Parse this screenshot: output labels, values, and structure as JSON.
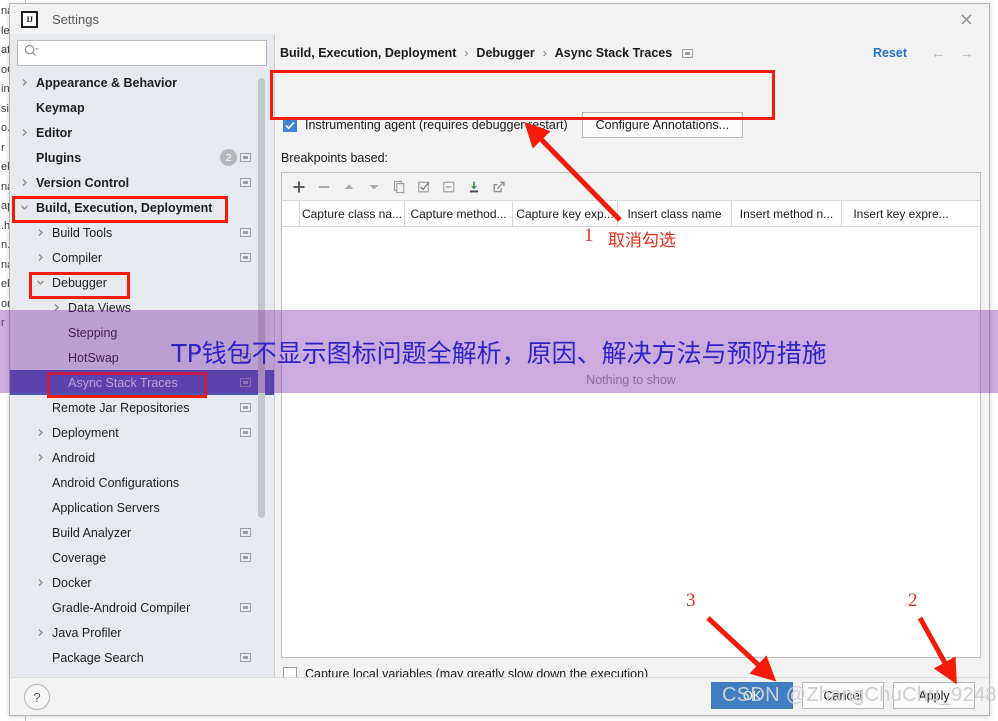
{
  "window": {
    "title": "Settings",
    "logo_text": "IJ",
    "close_icon": "close-icon"
  },
  "sidebar": {
    "search": {
      "value": "",
      "placeholder": "",
      "icon": "search-icon"
    },
    "items": [
      {
        "label": "Appearance & Behavior",
        "arrow": "right",
        "bold": true,
        "indent": 8,
        "badge": "",
        "mark": false,
        "selected": false
      },
      {
        "label": "Keymap",
        "arrow": "none",
        "bold": true,
        "indent": 8,
        "badge": "",
        "mark": false,
        "selected": false
      },
      {
        "label": "Editor",
        "arrow": "right",
        "bold": true,
        "indent": 8,
        "badge": "",
        "mark": false,
        "selected": false
      },
      {
        "label": "Plugins",
        "arrow": "none",
        "bold": true,
        "indent": 8,
        "badge": "2",
        "mark": true,
        "selected": false
      },
      {
        "label": "Version Control",
        "arrow": "right",
        "bold": true,
        "indent": 8,
        "badge": "",
        "mark": true,
        "selected": false
      },
      {
        "label": "Build, Execution, Deployment",
        "arrow": "down",
        "bold": true,
        "indent": 8,
        "badge": "",
        "mark": false,
        "selected": false
      },
      {
        "label": "Build Tools",
        "arrow": "right",
        "bold": false,
        "indent": 24,
        "badge": "",
        "mark": true,
        "selected": false
      },
      {
        "label": "Compiler",
        "arrow": "right",
        "bold": false,
        "indent": 24,
        "badge": "",
        "mark": true,
        "selected": false
      },
      {
        "label": "Debugger",
        "arrow": "down",
        "bold": false,
        "indent": 24,
        "badge": "",
        "mark": false,
        "selected": false
      },
      {
        "label": "Data Views",
        "arrow": "right",
        "bold": false,
        "indent": 40,
        "badge": "",
        "mark": false,
        "selected": false
      },
      {
        "label": "Stepping",
        "arrow": "none",
        "bold": false,
        "indent": 40,
        "badge": "",
        "mark": false,
        "selected": false
      },
      {
        "label": "HotSwap",
        "arrow": "none",
        "bold": false,
        "indent": 40,
        "badge": "",
        "mark": true,
        "selected": false
      },
      {
        "label": "Async Stack Traces",
        "arrow": "none",
        "bold": false,
        "indent": 40,
        "badge": "",
        "mark": true,
        "selected": true
      },
      {
        "label": "Remote Jar Repositories",
        "arrow": "none",
        "bold": false,
        "indent": 24,
        "badge": "",
        "mark": true,
        "selected": false
      },
      {
        "label": "Deployment",
        "arrow": "right",
        "bold": false,
        "indent": 24,
        "badge": "",
        "mark": true,
        "selected": false
      },
      {
        "label": "Android",
        "arrow": "right",
        "bold": false,
        "indent": 24,
        "badge": "",
        "mark": false,
        "selected": false
      },
      {
        "label": "Android Configurations",
        "arrow": "none",
        "bold": false,
        "indent": 24,
        "badge": "",
        "mark": false,
        "selected": false
      },
      {
        "label": "Application Servers",
        "arrow": "none",
        "bold": false,
        "indent": 24,
        "badge": "",
        "mark": false,
        "selected": false
      },
      {
        "label": "Build Analyzer",
        "arrow": "none",
        "bold": false,
        "indent": 24,
        "badge": "",
        "mark": true,
        "selected": false
      },
      {
        "label": "Coverage",
        "arrow": "none",
        "bold": false,
        "indent": 24,
        "badge": "",
        "mark": true,
        "selected": false
      },
      {
        "label": "Docker",
        "arrow": "right",
        "bold": false,
        "indent": 24,
        "badge": "",
        "mark": false,
        "selected": false
      },
      {
        "label": "Gradle-Android Compiler",
        "arrow": "none",
        "bold": false,
        "indent": 24,
        "badge": "",
        "mark": true,
        "selected": false
      },
      {
        "label": "Java Profiler",
        "arrow": "right",
        "bold": false,
        "indent": 24,
        "badge": "",
        "mark": false,
        "selected": false
      },
      {
        "label": "Package Search",
        "arrow": "none",
        "bold": false,
        "indent": 24,
        "badge": "",
        "mark": true,
        "selected": false
      }
    ]
  },
  "main": {
    "breadcrumb": [
      "Build, Execution, Deployment",
      "Debugger",
      "Async Stack Traces"
    ],
    "breadcrumb_separator": "›",
    "reset_label": "Reset",
    "nav_back_icon": "arrow-left-icon",
    "nav_forward_icon": "arrow-right-icon",
    "instrumenting_agent": {
      "label": "Instrumenting agent (requires debugger restart)",
      "checked": true
    },
    "configure_annotations_label": "Configure Annotations...",
    "breakpoints_label": "Breakpoints based:",
    "toolbar_icons": [
      "add-icon",
      "remove-icon",
      "move-up-icon",
      "move-down-icon",
      "copy-icon",
      "check-all-icon",
      "uncheck-all-icon",
      "import-icon",
      "export-icon"
    ],
    "table_columns": [
      "Capture class na...",
      "Capture method...",
      "Capture key exp...",
      "Insert class name",
      "Insert method n...",
      "Insert key expre..."
    ],
    "empty_text": "Nothing to show",
    "capture_local_variables": {
      "label": "Capture local variables (may greatly slow down the execution)",
      "checked": false
    }
  },
  "footer": {
    "help_label": "?",
    "buttons": [
      {
        "label": "OK",
        "primary": true
      },
      {
        "label": "Cancel",
        "primary": false
      },
      {
        "label": "Apply",
        "primary": false
      }
    ]
  },
  "annotations": {
    "step1_number": "1",
    "step1_text": "取消勾选",
    "step2_number": "2",
    "step3_number": "3",
    "red": "#f51b0a"
  },
  "overlay": {
    "banner_text": "TP钱包不显示图标问题全解析，原因、解决方法与预防措施",
    "banner_color": "#2f23c8",
    "watermark": "CSDN @ZhangChuChu_9248"
  },
  "background_strip": [
    "na",
    "le",
    "at",
    "oC",
    "in",
    "si",
    "o.",
    "r",
    "",
    "",
    "",
    "",
    "ek",
    "",
    "na",
    "ap",
    "",
    ".h",
    "n.",
    "na",
    "ek",
    "",
    "",
    "",
    "",
    "om",
    "",
    "r ",
    ""
  ]
}
